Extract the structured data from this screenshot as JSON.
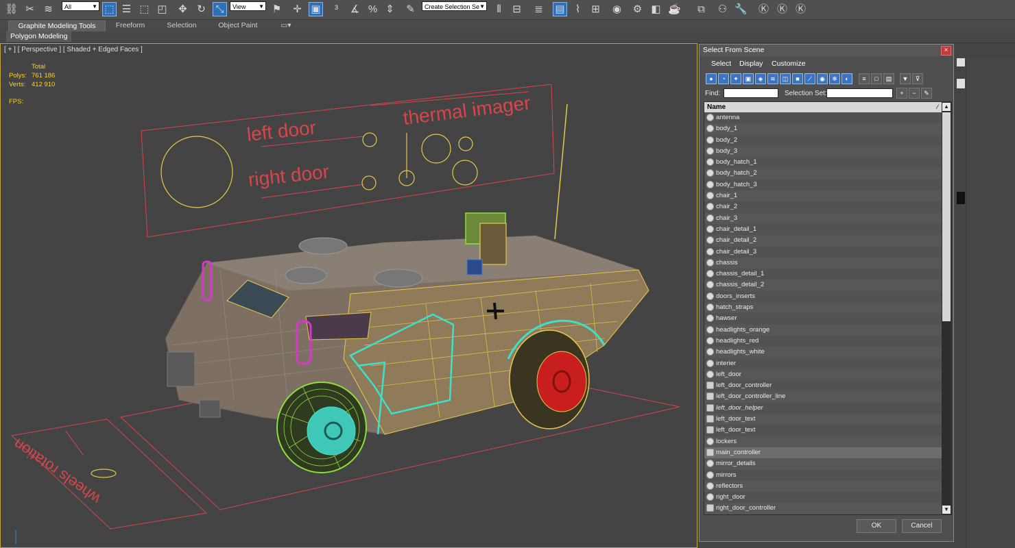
{
  "toolbar": {
    "selection_filter": "All",
    "ref_coord": "View",
    "named_selection": "Create Selection Se"
  },
  "ribbon": {
    "tabs": [
      "Graphite Modeling Tools",
      "Freeform",
      "Selection",
      "Object Paint"
    ],
    "sub_label": "Polygon Modeling"
  },
  "viewport": {
    "label": "[ + ] [ Perspective ] [ Shaded + Edged Faces ]",
    "stats": {
      "header": "Total",
      "polys_label": "Polys:",
      "polys_value": "761 186",
      "verts_label": "Verts:",
      "verts_value": "412 910",
      "fps_label": "FPS:"
    },
    "scene_labels": {
      "left_door": "left door",
      "right_door": "right door",
      "thermal_imager": "thermal imager",
      "wheels_rotation": "wheels rotation"
    }
  },
  "dialog": {
    "title": "Select From Scene",
    "menu": [
      "Select",
      "Display",
      "Customize"
    ],
    "find_label": "Find:",
    "find_value": "",
    "selection_set_label": "Selection Set:",
    "selection_set_value": "",
    "column_header": "Name",
    "items": [
      {
        "name": "antenna",
        "type": "object"
      },
      {
        "name": "body_1",
        "type": "object"
      },
      {
        "name": "body_2",
        "type": "object"
      },
      {
        "name": "body_3",
        "type": "object"
      },
      {
        "name": "body_hatch_1",
        "type": "object"
      },
      {
        "name": "body_hatch_2",
        "type": "object"
      },
      {
        "name": "body_hatch_3",
        "type": "object"
      },
      {
        "name": "chair_1",
        "type": "object"
      },
      {
        "name": "chair_2",
        "type": "object"
      },
      {
        "name": "chair_3",
        "type": "object"
      },
      {
        "name": "chair_detail_1",
        "type": "object"
      },
      {
        "name": "chair_detail_2",
        "type": "object"
      },
      {
        "name": "chair_detail_3",
        "type": "object"
      },
      {
        "name": "chassis",
        "type": "object"
      },
      {
        "name": "chassis_detail_1",
        "type": "object"
      },
      {
        "name": "chassis_detail_2",
        "type": "object"
      },
      {
        "name": "doors_inserts",
        "type": "object"
      },
      {
        "name": "hatch_straps",
        "type": "object"
      },
      {
        "name": "hawser",
        "type": "object"
      },
      {
        "name": "headlights_orange",
        "type": "object"
      },
      {
        "name": "headlights_red",
        "type": "object"
      },
      {
        "name": "headlights_white",
        "type": "object"
      },
      {
        "name": "interier",
        "type": "object"
      },
      {
        "name": "left_door",
        "type": "object"
      },
      {
        "name": "left_door_controller",
        "type": "helper"
      },
      {
        "name": "left_door_controller_line",
        "type": "helper"
      },
      {
        "name": "left_door_helper",
        "type": "helper",
        "italic": true
      },
      {
        "name": "left_door_text",
        "type": "helper"
      },
      {
        "name": "left_door_text",
        "type": "helper"
      },
      {
        "name": "lockers",
        "type": "object"
      },
      {
        "name": "main_controller",
        "type": "helper",
        "selected": true
      },
      {
        "name": "mirror_details",
        "type": "object"
      },
      {
        "name": "mirrors",
        "type": "object"
      },
      {
        "name": "reflectors",
        "type": "object"
      },
      {
        "name": "right_door",
        "type": "object"
      },
      {
        "name": "right_door_controller",
        "type": "helper"
      }
    ],
    "ok_label": "OK",
    "cancel_label": "Cancel"
  },
  "colors": {
    "accent_blue": "#3d74c2",
    "stats_yellow": "#ffd21e",
    "label_red": "#d8454b",
    "wire_yellow": "#e8c84a",
    "wire_cyan": "#3fe0c8",
    "wire_green": "#8ee03a",
    "wire_magenta": "#d838c8"
  }
}
